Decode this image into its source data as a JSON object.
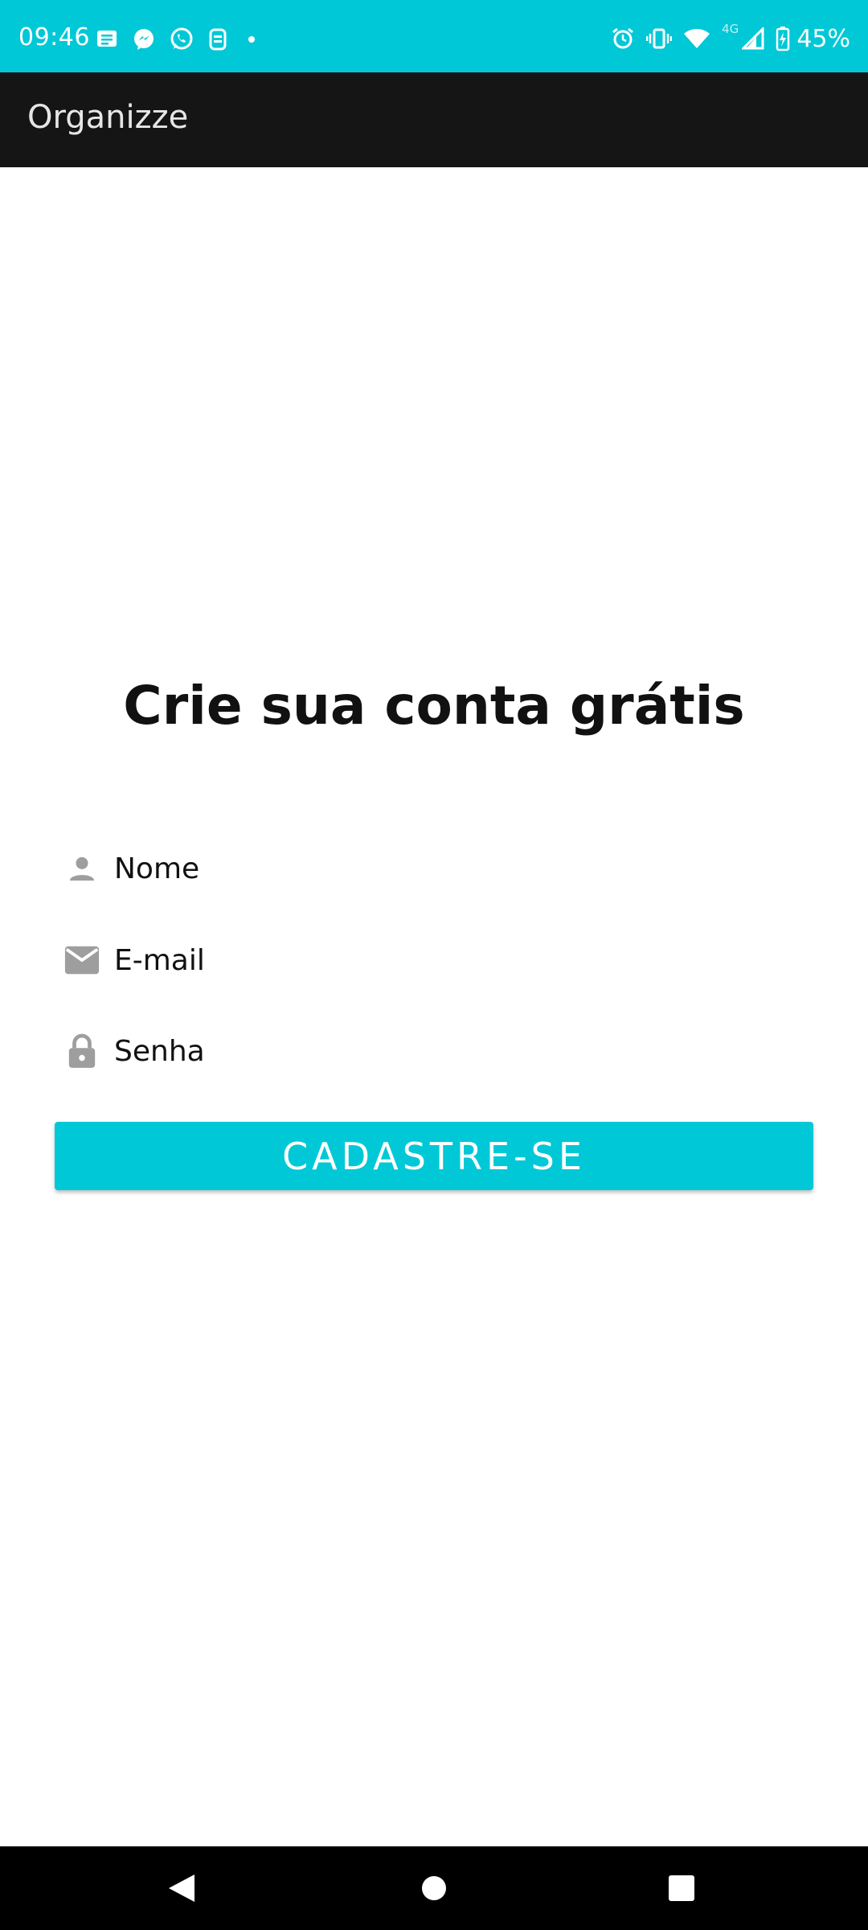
{
  "status_bar": {
    "time": "09:46",
    "network_label": "4G",
    "battery_percent": "45%",
    "notification_icons": [
      "message-icon",
      "messenger-icon",
      "whatsapp-icon",
      "app-icon",
      "more-dot-icon"
    ],
    "system_icons": [
      "alarm-icon",
      "vibrate-icon",
      "wifi-icon",
      "signal-icon",
      "battery-charging-icon"
    ],
    "background_color": "#00c8d6"
  },
  "app_bar": {
    "title": "Organizze",
    "background_color": "#151515"
  },
  "form": {
    "title": "Crie sua conta grátis",
    "fields": [
      {
        "placeholder": "Nome",
        "icon": "person-icon"
      },
      {
        "placeholder": "E-mail",
        "icon": "email-icon"
      },
      {
        "placeholder": "Senha",
        "icon": "lock-icon"
      }
    ],
    "submit_label": "CADASTRE-SE",
    "accent_color": "#00c8d6"
  },
  "nav_bar": {
    "buttons": [
      "back-icon",
      "home-icon",
      "recents-icon"
    ]
  }
}
